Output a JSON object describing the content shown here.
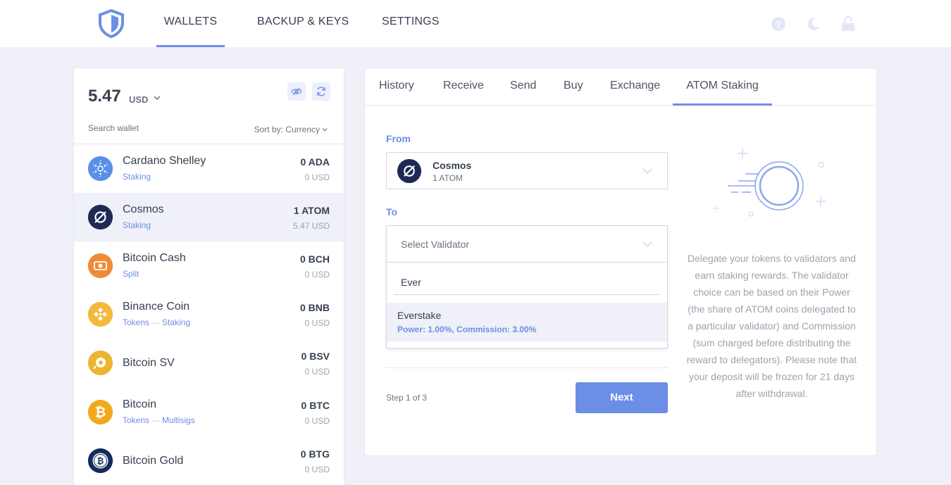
{
  "nav": {
    "items": [
      {
        "label": "WALLETS",
        "active": true
      },
      {
        "label": "BACKUP & KEYS",
        "active": false
      },
      {
        "label": "SETTINGS",
        "active": false
      }
    ],
    "icons": [
      "help-icon",
      "moon-icon",
      "lock-icon"
    ]
  },
  "wallet": {
    "balance": "5.47",
    "currency": "USD",
    "search_label": "Search wallet",
    "sort_label": "Sort by: Currency",
    "coins": [
      {
        "name": "Cardano Shelley",
        "tags": [
          "Staking"
        ],
        "amount": "0 ADA",
        "usd": "0 USD",
        "color": "#4f8be6"
      },
      {
        "name": "Cosmos",
        "tags": [
          "Staking"
        ],
        "amount": "1 ATOM",
        "usd": "5.47 USD",
        "color": "#1e2a55",
        "selected": true
      },
      {
        "name": "Bitcoin Cash",
        "tags": [
          "Split"
        ],
        "amount": "0 BCH",
        "usd": "0 USD",
        "color": "#f08a34"
      },
      {
        "name": "Binance Coin",
        "tags": [
          "Tokens",
          "Staking"
        ],
        "amount": "0 BNB",
        "usd": "0 USD",
        "color": "#f3b93a"
      },
      {
        "name": "Bitcoin SV",
        "tags": [],
        "amount": "0 BSV",
        "usd": "0 USD",
        "color": "#eab531"
      },
      {
        "name": "Bitcoin",
        "tags": [
          "Tokens",
          "Multisigs"
        ],
        "amount": "0 BTC",
        "usd": "0 USD",
        "color": "#f3a81a"
      },
      {
        "name": "Bitcoin Gold",
        "tags": [],
        "amount": "0 BTG",
        "usd": "0 USD",
        "color": "#142c5c"
      }
    ]
  },
  "tabs": [
    {
      "label": "History",
      "active": false
    },
    {
      "label": "Receive",
      "active": false
    },
    {
      "label": "Send",
      "active": false
    },
    {
      "label": "Buy",
      "active": false
    },
    {
      "label": "Exchange",
      "active": false
    },
    {
      "label": "ATOM Staking",
      "active": true
    }
  ],
  "staking": {
    "from_label": "From",
    "from_name": "Cosmos",
    "from_sub": "1 ATOM",
    "to_label": "To",
    "validator_placeholder": "Select Validator",
    "search_value": "Ever",
    "option_name": "Everstake",
    "option_detail": "Power: 1.00%, Commission: 3.00%",
    "step_label": "Step 1 of 3",
    "next_label": "Next",
    "info_text": "Delegate your tokens to validators and earn staking rewards. The validator choice can be based on their Power (the share of ATOM coins delegated to a particular validator) and Commission (sum charged before distributing the reward to delegators). Please note that your deposit will be frozen for 21 days after withdrawal."
  },
  "colors": {
    "accent": "#6d8ee6",
    "background": "#eff0f8"
  }
}
